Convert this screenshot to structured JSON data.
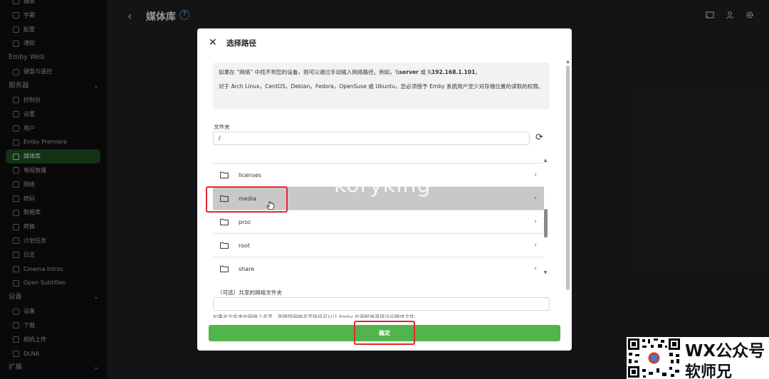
{
  "sidebar": {
    "top_items": [
      {
        "label": "播放",
        "icon": "play-icon"
      },
      {
        "label": "字幕",
        "icon": "subtitles-icon"
      },
      {
        "label": "配置",
        "icon": "user-profile-icon"
      },
      {
        "label": "通知",
        "icon": "bell-icon"
      }
    ],
    "sections": [
      {
        "title": "Emby Web",
        "collapsible": false,
        "items": [
          {
            "label": "键盘与遥控",
            "icon": "keyboard-icon"
          }
        ]
      },
      {
        "title": "服务器",
        "collapsible": true,
        "items": [
          {
            "label": "控制台",
            "icon": "dashboard-icon"
          },
          {
            "label": "设置",
            "icon": "settings-icon"
          },
          {
            "label": "用户",
            "icon": "users-icon"
          },
          {
            "label": "Emby Premiere",
            "icon": "premiere-icon"
          },
          {
            "label": "媒体库",
            "icon": "folder-icon",
            "active": true
          },
          {
            "label": "电视直播",
            "icon": "tv-icon"
          },
          {
            "label": "网络",
            "icon": "wifi-icon"
          },
          {
            "label": "转码",
            "icon": "transcode-icon"
          },
          {
            "label": "数据库",
            "icon": "database-icon"
          },
          {
            "label": "转换",
            "icon": "convert-icon"
          },
          {
            "label": "计划任务",
            "icon": "clock-icon"
          },
          {
            "label": "日志",
            "icon": "log-icon"
          },
          {
            "label": "Cinema Intros",
            "icon": "film-icon"
          },
          {
            "label": "Open Subtitles",
            "icon": "subtitles-icon"
          }
        ]
      },
      {
        "title": "设备",
        "collapsible": true,
        "items": [
          {
            "label": "设备",
            "icon": "devices-icon"
          },
          {
            "label": "下载",
            "icon": "download-icon"
          },
          {
            "label": "相机上传",
            "icon": "camera-icon"
          },
          {
            "label": "DLNA",
            "icon": "dlna-icon"
          }
        ]
      },
      {
        "title": "扩展",
        "collapsible": true,
        "items": []
      }
    ]
  },
  "header": {
    "title": "媒体库",
    "help_glyph": "?"
  },
  "dialog": {
    "title": "选择路径",
    "info_line1_prefix": "如果在 “网络” 中找不到您的设备，则可以通过手动输入网络路径。例如，",
    "info_server": "\\\\server",
    "info_or": " 或 ",
    "info_ip": "\\\\192.168.1.101",
    "info_line1_suffix": "。",
    "info_line2": "对于 Arch Linux，CentOS，Debian，Fedora，OpenSuse 或 Ubuntu，您必须授予 Emby 系统用户至少对存储位置的读取的权限。",
    "folder_label": "文件夹",
    "folder_value": "/",
    "folders": [
      {
        "name": ""
      },
      {
        "name": "licenses"
      },
      {
        "name": "media",
        "hover": true
      },
      {
        "name": "proc"
      },
      {
        "name": "root"
      },
      {
        "name": "share"
      }
    ],
    "share_label": "（可选）共享的网络文件夹",
    "share_value": "",
    "share_note": "如果此文件夹在网络上共享，则提供网络共享路径可以让 Emby 应用程序直接访问媒体文件。",
    "ok_label": "确定"
  },
  "watermark": "koryking",
  "badge": {
    "line1": "WX公众号",
    "line2": "软师兄"
  },
  "colors": {
    "accent_green": "#52b54b",
    "highlight_red": "#e0282e",
    "help_blue": "#3a8fd6"
  }
}
